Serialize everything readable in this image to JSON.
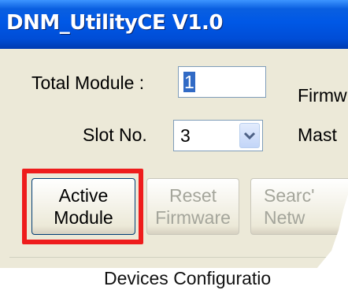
{
  "window": {
    "title": "DNM_UtilityCE V1.0"
  },
  "form": {
    "total_module_label": "Total Module :",
    "total_module_value": "1",
    "slot_label": "Slot No.",
    "slot_value": "3",
    "firmware_label": "Firmw",
    "master_label": "Mast"
  },
  "buttons": {
    "active_module": [
      "Active",
      "Module"
    ],
    "reset_firmware": [
      "Reset",
      "Firmware"
    ],
    "search_network": [
      "Searc'",
      "Netw"
    ]
  },
  "group": {
    "label": "Devices Configuratio"
  },
  "colors": {
    "titlebar": "#0058e6",
    "highlight": "#ee1c1c",
    "selection": "#316ac5"
  },
  "icons": {
    "dropdown": "chevron-down-icon"
  }
}
